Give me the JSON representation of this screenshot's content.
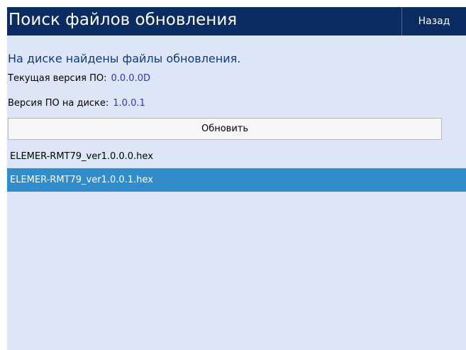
{
  "header": {
    "title": "Поиск файлов обновления",
    "back_label": "Назад"
  },
  "message": "На диске найдены файлы обновления.",
  "current_version": {
    "label": "Текущая версия ПО:",
    "value": "0.0.0.0D"
  },
  "disk_version": {
    "label": "Версия ПО на диске:",
    "value": "1.0.0.1"
  },
  "update_button_label": "Обновить",
  "files": [
    {
      "name": "ELEMER-RMT79_ver1.0.0.0.hex",
      "selected": false
    },
    {
      "name": "ELEMER-RMT79_ver1.0.0.1.hex",
      "selected": true
    }
  ],
  "colors": {
    "header_bg": "#0a2c63",
    "screen_bg": "#dde6f6",
    "selected_bg": "#318ccc",
    "message_text": "#0c3a82",
    "value_text": "#2c33c8"
  }
}
